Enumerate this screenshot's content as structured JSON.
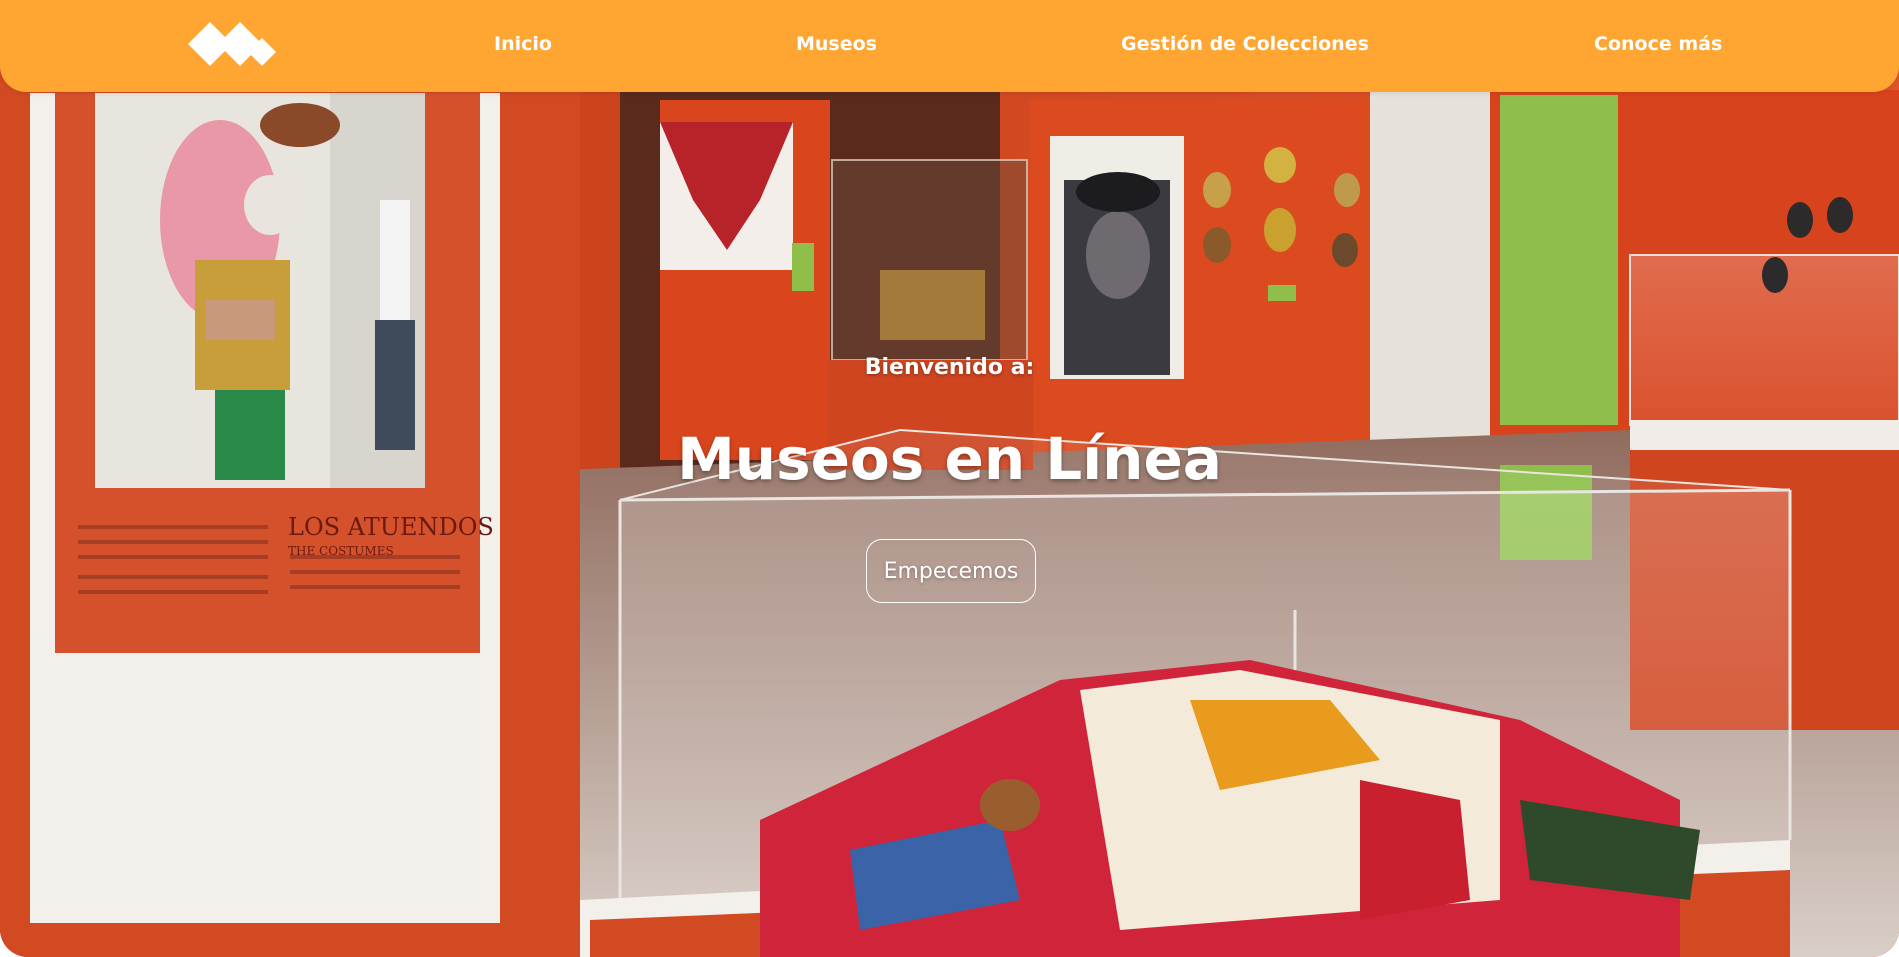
{
  "nav": {
    "logo_name": "diamond-logo",
    "items": [
      {
        "label": "Inicio"
      },
      {
        "label": "Museos"
      },
      {
        "label": "Gestión de Colecciones"
      },
      {
        "label": "Conoce más"
      }
    ]
  },
  "hero": {
    "welcome": "Bienvenido a:",
    "title": "Museos en Línea",
    "cta_label": "Empecemos"
  },
  "poster": {
    "heading": "LOS ATUENDOS",
    "subheading": "THE COSTUMES"
  },
  "colors": {
    "nav_background": "#ffa532",
    "gallery_wall": "#d8431c",
    "text": "#ffffff"
  }
}
